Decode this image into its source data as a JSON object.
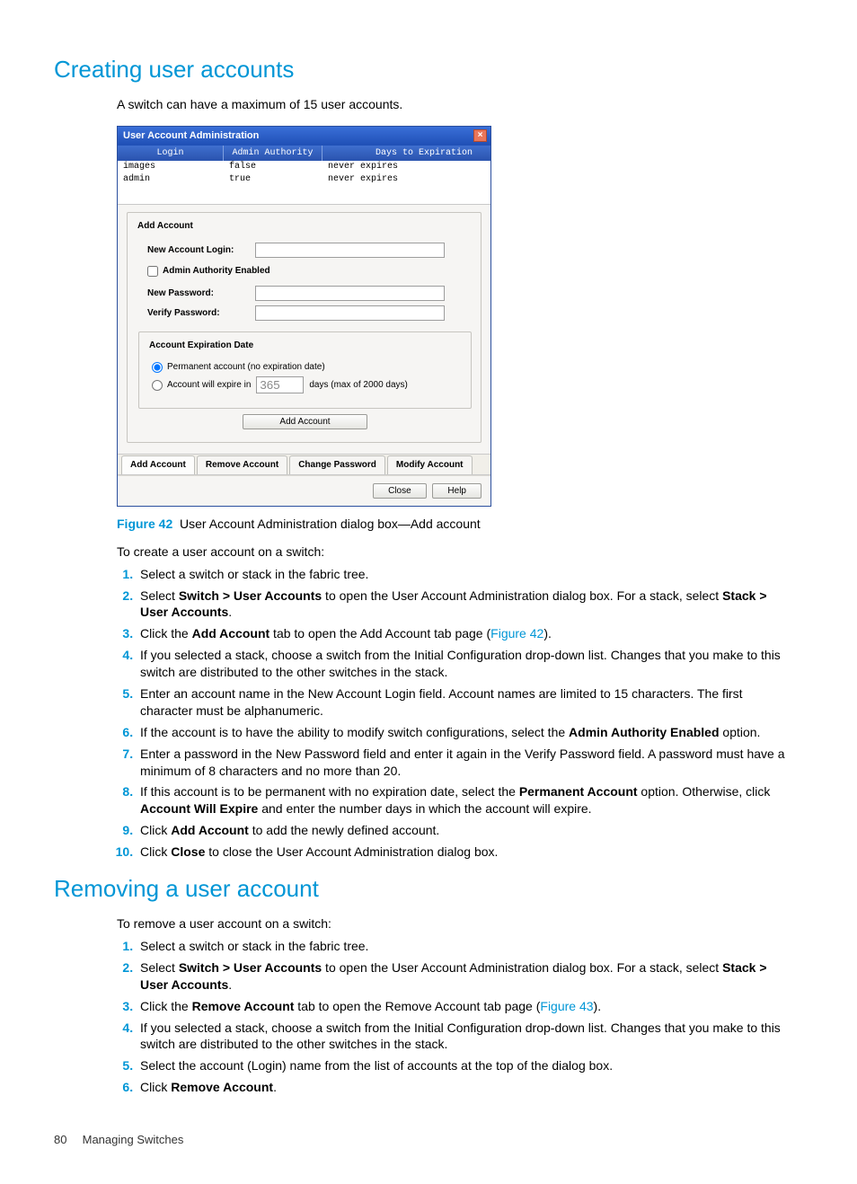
{
  "heading1": "Creating user accounts",
  "intro1": "A switch can have a maximum of 15 user accounts.",
  "dialog": {
    "title": "User Account Administration",
    "columns": {
      "login": "Login",
      "admin": "Admin Authority",
      "days": "Days to Expiration"
    },
    "rows": [
      {
        "login": "images",
        "admin": "false",
        "days": "never expires"
      },
      {
        "login": "admin",
        "admin": "true",
        "days": "never expires"
      }
    ],
    "add_legend": "Add Account",
    "new_login_label": "New Account Login:",
    "admin_auth_label": "Admin Authority Enabled",
    "new_pw_label": "New Password:",
    "verify_pw_label": "Verify Password:",
    "exp_legend": "Account Expiration Date",
    "perm_label": "Permanent account (no expiration date)",
    "expire_prefix": "Account will expire in",
    "expire_days": "365",
    "expire_suffix": "days (max of 2000 days)",
    "add_btn": "Add Account",
    "tabs": {
      "add": "Add Account",
      "remove": "Remove Account",
      "change": "Change Password",
      "modify": "Modify Account"
    },
    "close_btn": "Close",
    "help_btn": "Help"
  },
  "figure": {
    "label": "Figure 42",
    "caption": "User Account Administration dialog box—Add account"
  },
  "create_lead": "To create a user account on a switch:",
  "create_steps": {
    "s1": "Select a switch or stack in the fabric tree.",
    "s2a": "Select ",
    "s2b": "Switch > User Accounts",
    "s2c": " to open the User Account Administration dialog box. For a stack, select ",
    "s2d": "Stack > User Accounts",
    "s2e": ".",
    "s3a": "Click the ",
    "s3b": "Add Account",
    "s3c": " tab to open the Add Account tab page (",
    "s3d": "Figure 42",
    "s3e": ").",
    "s4": "If you selected a stack, choose a switch from the Initial Configuration drop-down list. Changes that you make to this switch are distributed to the other switches in the stack.",
    "s5": "Enter an account name in the New Account Login field. Account names are limited to 15 characters. The first character must be alphanumeric.",
    "s6a": "If the account is to have the ability to modify switch configurations, select the ",
    "s6b": "Admin Authority Enabled",
    "s6c": " option.",
    "s7": "Enter a password in the New Password field and enter it again in the Verify Password field. A password must have a minimum of 8 characters and no more than 20.",
    "s8a": "If this account is to be permanent with no expiration date, select the ",
    "s8b": "Permanent Account",
    "s8c": " option. Otherwise, click ",
    "s8d": "Account Will Expire",
    "s8e": " and enter the number days in which the account will expire.",
    "s9a": "Click ",
    "s9b": "Add Account",
    "s9c": " to add the newly defined account.",
    "s10a": "Click ",
    "s10b": "Close",
    "s10c": " to close the User Account Administration dialog box."
  },
  "heading2": "Removing a user account",
  "remove_lead": "To remove a user account on a switch:",
  "remove_steps": {
    "s1": "Select a switch or stack in the fabric tree.",
    "s2a": "Select ",
    "s2b": "Switch > User Accounts",
    "s2c": " to open the User Account Administration dialog box. For a stack, select ",
    "s2d": "Stack > User Accounts",
    "s2e": ".",
    "s3a": "Click the ",
    "s3b": "Remove Account",
    "s3c": " tab to open the Remove Account tab page (",
    "s3d": "Figure 43",
    "s3e": ").",
    "s4": "If you selected a stack, choose a switch from the Initial Configuration drop-down list. Changes that you make to this switch are distributed to the other switches in the stack.",
    "s5": "Select the account (Login) name from the list of accounts at the top of the dialog box.",
    "s6a": "Click ",
    "s6b": "Remove Account",
    "s6c": "."
  },
  "footer": {
    "page": "80",
    "chapter": "Managing Switches"
  }
}
